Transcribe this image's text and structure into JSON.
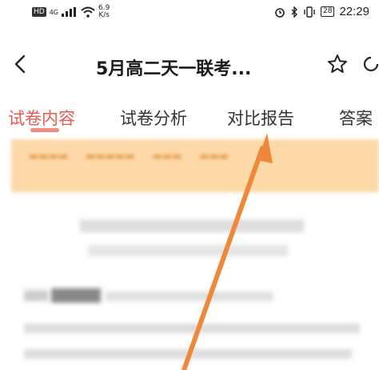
{
  "status_bar": {
    "hd": "HD",
    "network": "4G",
    "speed_value": "6.9",
    "speed_unit": "K/s",
    "battery": "28",
    "time": "22:29"
  },
  "header": {
    "title": "5月高二天一联考..."
  },
  "tabs": [
    {
      "label": "试卷内容",
      "active": true
    },
    {
      "label": "试卷分析",
      "active": false
    },
    {
      "label": "对比报告",
      "active": false
    },
    {
      "label": "答案",
      "active": false
    }
  ],
  "colors": {
    "accent": "#e85a4f",
    "banner": "#fdd9a8",
    "arrow": "#f0883a"
  },
  "icons": [
    "back-arrow-icon",
    "star-icon",
    "refresh-icon",
    "alarm-icon",
    "bluetooth-icon",
    "vibrate-icon",
    "wifi-icon"
  ]
}
